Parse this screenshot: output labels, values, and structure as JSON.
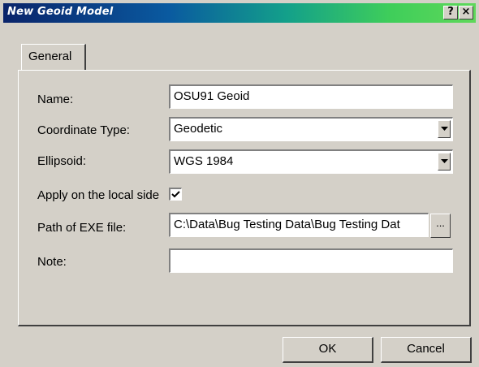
{
  "window": {
    "title": "New Geoid Model",
    "help_glyph": "?",
    "close_glyph": "×"
  },
  "tabs": [
    {
      "label": "General"
    }
  ],
  "form": {
    "name": {
      "label": "Name:",
      "value": "OSU91 Geoid"
    },
    "coordinate_type": {
      "label": "Coordinate Type:",
      "value": "Geodetic"
    },
    "ellipsoid": {
      "label": "Ellipsoid:",
      "value": "WGS 1984"
    },
    "apply_local": {
      "label": "Apply on the local side",
      "checked": true
    },
    "exe_path": {
      "label": "Path of EXE file:",
      "value": "C:\\Data\\Bug Testing Data\\Bug Testing Dat",
      "browse_label": "..."
    },
    "note": {
      "label": "Note:",
      "value": ""
    }
  },
  "buttons": {
    "ok": "OK",
    "cancel": "Cancel"
  }
}
